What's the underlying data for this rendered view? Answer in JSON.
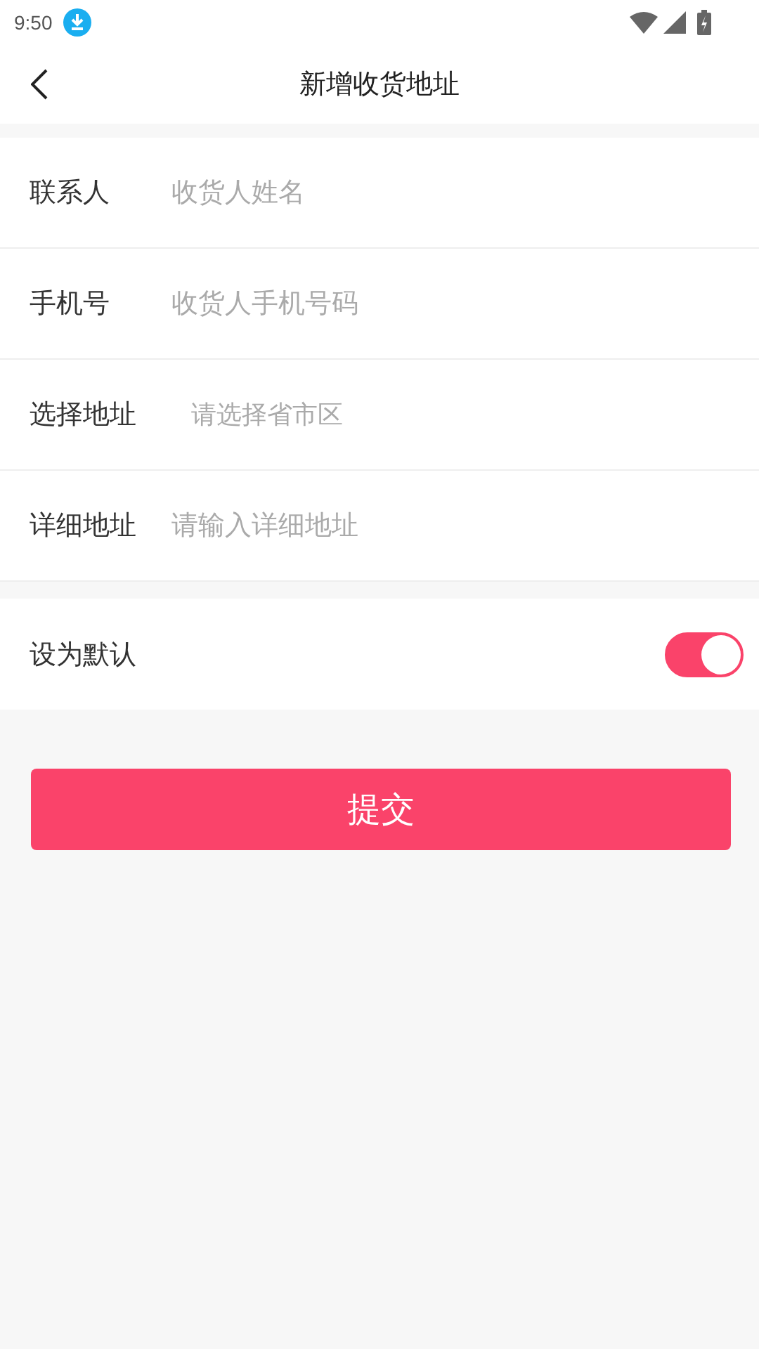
{
  "status_bar": {
    "time": "9:50"
  },
  "header": {
    "title": "新增收货地址"
  },
  "fields": [
    {
      "kind": "input",
      "label": "联系人",
      "placeholder": "收货人姓名"
    },
    {
      "kind": "input",
      "label": "手机号",
      "placeholder": "收货人手机号码"
    },
    {
      "kind": "picker",
      "label": "选择地址",
      "placeholder": "请选择省市区"
    },
    {
      "kind": "input",
      "label": "详细地址",
      "placeholder": "请输入详细地址"
    }
  ],
  "default_setting": {
    "label": "设为默认",
    "on": true
  },
  "submit_button": {
    "label": "提交"
  }
}
